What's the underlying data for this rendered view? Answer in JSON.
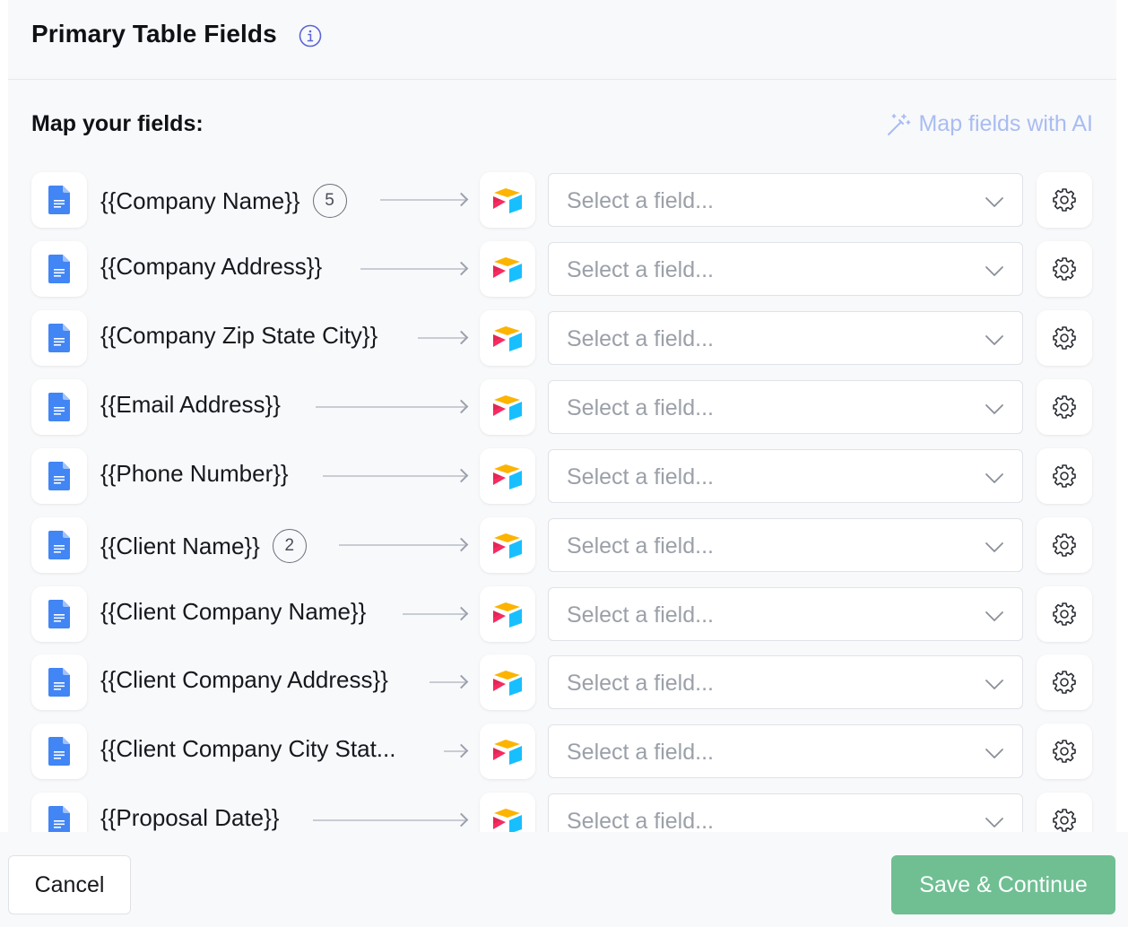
{
  "header": {
    "title": "Primary Table Fields",
    "info_icon": "info-icon"
  },
  "section": {
    "label": "Map your fields:",
    "ai_link": "Map fields with AI",
    "ai_icon": "magic-wand-icon"
  },
  "rows": [
    {
      "token": "{{Company Name}}",
      "badge": "5",
      "placeholder": "Select a field..."
    },
    {
      "token": "{{Company Address}}",
      "badge": "",
      "placeholder": "Select a field..."
    },
    {
      "token": "{{Company Zip State City}}",
      "badge": "",
      "placeholder": "Select a field..."
    },
    {
      "token": "{{Email Address}}",
      "badge": "",
      "placeholder": "Select a field..."
    },
    {
      "token": "{{Phone Number}}",
      "badge": "",
      "placeholder": "Select a field..."
    },
    {
      "token": "{{Client Name}}",
      "badge": "2",
      "placeholder": "Select a field..."
    },
    {
      "token": "{{Client Company Name}}",
      "badge": "",
      "placeholder": "Select a field..."
    },
    {
      "token": "{{Client Company Address}}",
      "badge": "",
      "placeholder": "Select a field..."
    },
    {
      "token": "{{Client Company City Stat...",
      "badge": "",
      "placeholder": "Select a field..."
    },
    {
      "token": "{{Proposal Date}}",
      "badge": "",
      "placeholder": "Select a field..."
    }
  ],
  "footer": {
    "cancel_label": "Cancel",
    "save_label": "Save & Continue"
  },
  "colors": {
    "accent_green": "#6fbf93",
    "ai_link": "#a9bcf2",
    "doc_blue": "#4285f4"
  }
}
